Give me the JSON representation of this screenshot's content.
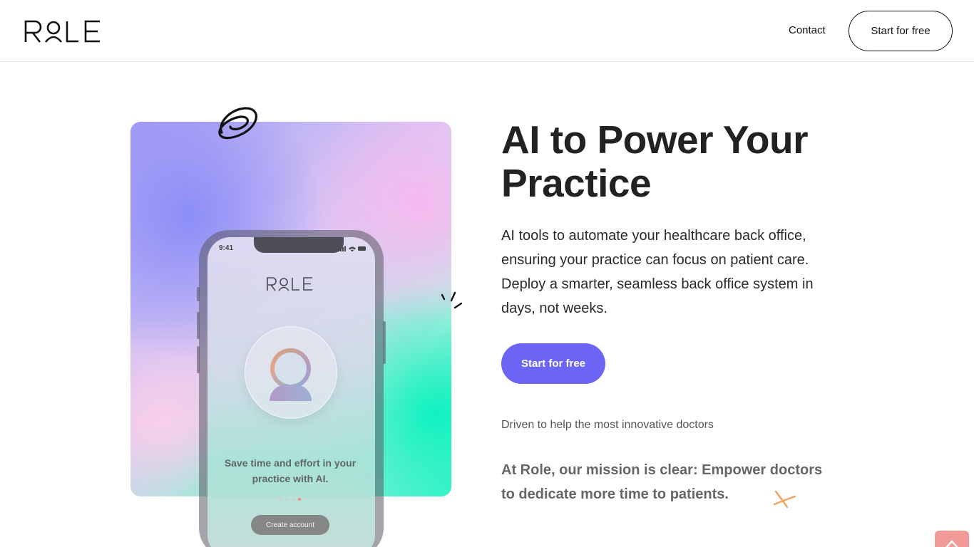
{
  "header": {
    "logo_text": "ROLE",
    "nav": {
      "contact_label": "Contact",
      "cta_label": "Start for free"
    }
  },
  "hero": {
    "title": "AI to Power Your Practice",
    "description": "AI tools to automate your healthcare back office, ensuring your practice can focus on patient care. Deploy a smarter, seamless back office system in days, not weeks.",
    "cta_label": "Start for free",
    "driven_text": "Driven to help the most innovative doctors",
    "mission_text": "At Role, our mission is clear: Empower doctors to dedicate more time to patients."
  },
  "phone": {
    "status_time": "9:41",
    "logo_text": "ROLE",
    "tagline": "Save time and effort in your practice with AI.",
    "cta_label": "Create account",
    "pager": {
      "count": 4,
      "active_index": 3
    }
  },
  "colors": {
    "primary": "#6b64f5",
    "accent_orange": "#f28b6a",
    "scroll_button": "#f29a98",
    "text_dark": "#222222"
  },
  "icons": {
    "scroll_top": "arrow-up-icon",
    "swirl": "swirl-doodle-icon",
    "spark": "spark-doodle-icon",
    "cross": "cross-doodle-icon"
  }
}
